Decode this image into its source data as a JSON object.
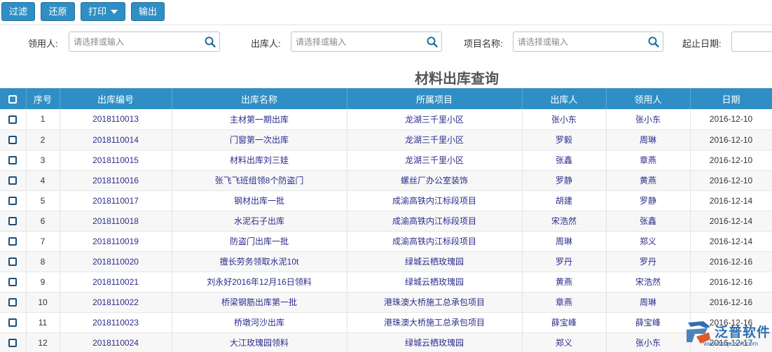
{
  "toolbar": {
    "filter_label": "过滤",
    "reset_label": "还原",
    "print_label": "打印",
    "export_label": "输出"
  },
  "filters": {
    "recipient_label": "领用人:",
    "recipient_placeholder": "请选择或输入",
    "issuer_label": "出库人:",
    "issuer_placeholder": "请选择或输入",
    "project_label": "项目名称:",
    "project_placeholder": "请选择或输入",
    "date_label": "起止日期:"
  },
  "page": {
    "title": "材料出库查询"
  },
  "table": {
    "headers": [
      "序号",
      "出库编号",
      "出库名称",
      "所属项目",
      "出库人",
      "领用人",
      "日期"
    ],
    "rows": [
      {
        "seq": "1",
        "code": "2018110013",
        "name": "主材第一期出库",
        "project": "龙湖三千里小区",
        "issuer": "张小东",
        "recipient": "张小东",
        "date": "2016-12-10"
      },
      {
        "seq": "2",
        "code": "2018110014",
        "name": "门窗第一次出库",
        "project": "龙湖三千里小区",
        "issuer": "罗毅",
        "recipient": "周琳",
        "date": "2016-12-10"
      },
      {
        "seq": "3",
        "code": "2018110015",
        "name": "材料出库刘三娃",
        "project": "龙湖三千里小区",
        "issuer": "张鑫",
        "recipient": "章燕",
        "date": "2016-12-10"
      },
      {
        "seq": "4",
        "code": "2018110016",
        "name": "张飞飞班组领8个防盗门",
        "project": "螺丝厂办公室装饰",
        "issuer": "罗静",
        "recipient": "黄燕",
        "date": "2016-12-10"
      },
      {
        "seq": "5",
        "code": "2018110017",
        "name": "钢材出库一批",
        "project": "成渝高铁内江标段项目",
        "issuer": "胡建",
        "recipient": "罗静",
        "date": "2016-12-14"
      },
      {
        "seq": "6",
        "code": "2018110018",
        "name": "水泥石子出库",
        "project": "成渝高铁内江标段项目",
        "issuer": "宋浩然",
        "recipient": "张鑫",
        "date": "2016-12-14"
      },
      {
        "seq": "7",
        "code": "2018110019",
        "name": "防盗门出库一批",
        "project": "成渝高铁内江标段项目",
        "issuer": "周琳",
        "recipient": "郑义",
        "date": "2016-12-14"
      },
      {
        "seq": "8",
        "code": "2018110020",
        "name": "擅长劳务领取水泥10t",
        "project": "绿城云栖玫瑰园",
        "issuer": "罗丹",
        "recipient": "罗丹",
        "date": "2016-12-16"
      },
      {
        "seq": "9",
        "code": "2018110021",
        "name": "刘永好2016年12月16日领料",
        "project": "绿城云栖玫瑰园",
        "issuer": "黄燕",
        "recipient": "宋浩然",
        "date": "2016-12-16"
      },
      {
        "seq": "10",
        "code": "2018110022",
        "name": "桥梁钢筋出库第一批",
        "project": "港珠澳大桥施工总承包项目",
        "issuer": "章燕",
        "recipient": "周琳",
        "date": "2016-12-16"
      },
      {
        "seq": "11",
        "code": "2018110023",
        "name": "桥墩河沙出库",
        "project": "港珠澳大桥施工总承包项目",
        "issuer": "薛宝峰",
        "recipient": "薛宝峰",
        "date": "2016-12-16"
      },
      {
        "seq": "12",
        "code": "2018110024",
        "name": "大江玫瑰园领料",
        "project": "绿城云栖玫瑰园",
        "issuer": "郑义",
        "recipient": "张小东",
        "date": "2016-12-17"
      }
    ]
  },
  "brand": {
    "name": "泛普软件",
    "sub": "www.fanpusoft.com",
    "color": "#2f6fb0"
  },
  "colors": {
    "accent": "#2f8fc4",
    "link": "#2c2c8c"
  }
}
